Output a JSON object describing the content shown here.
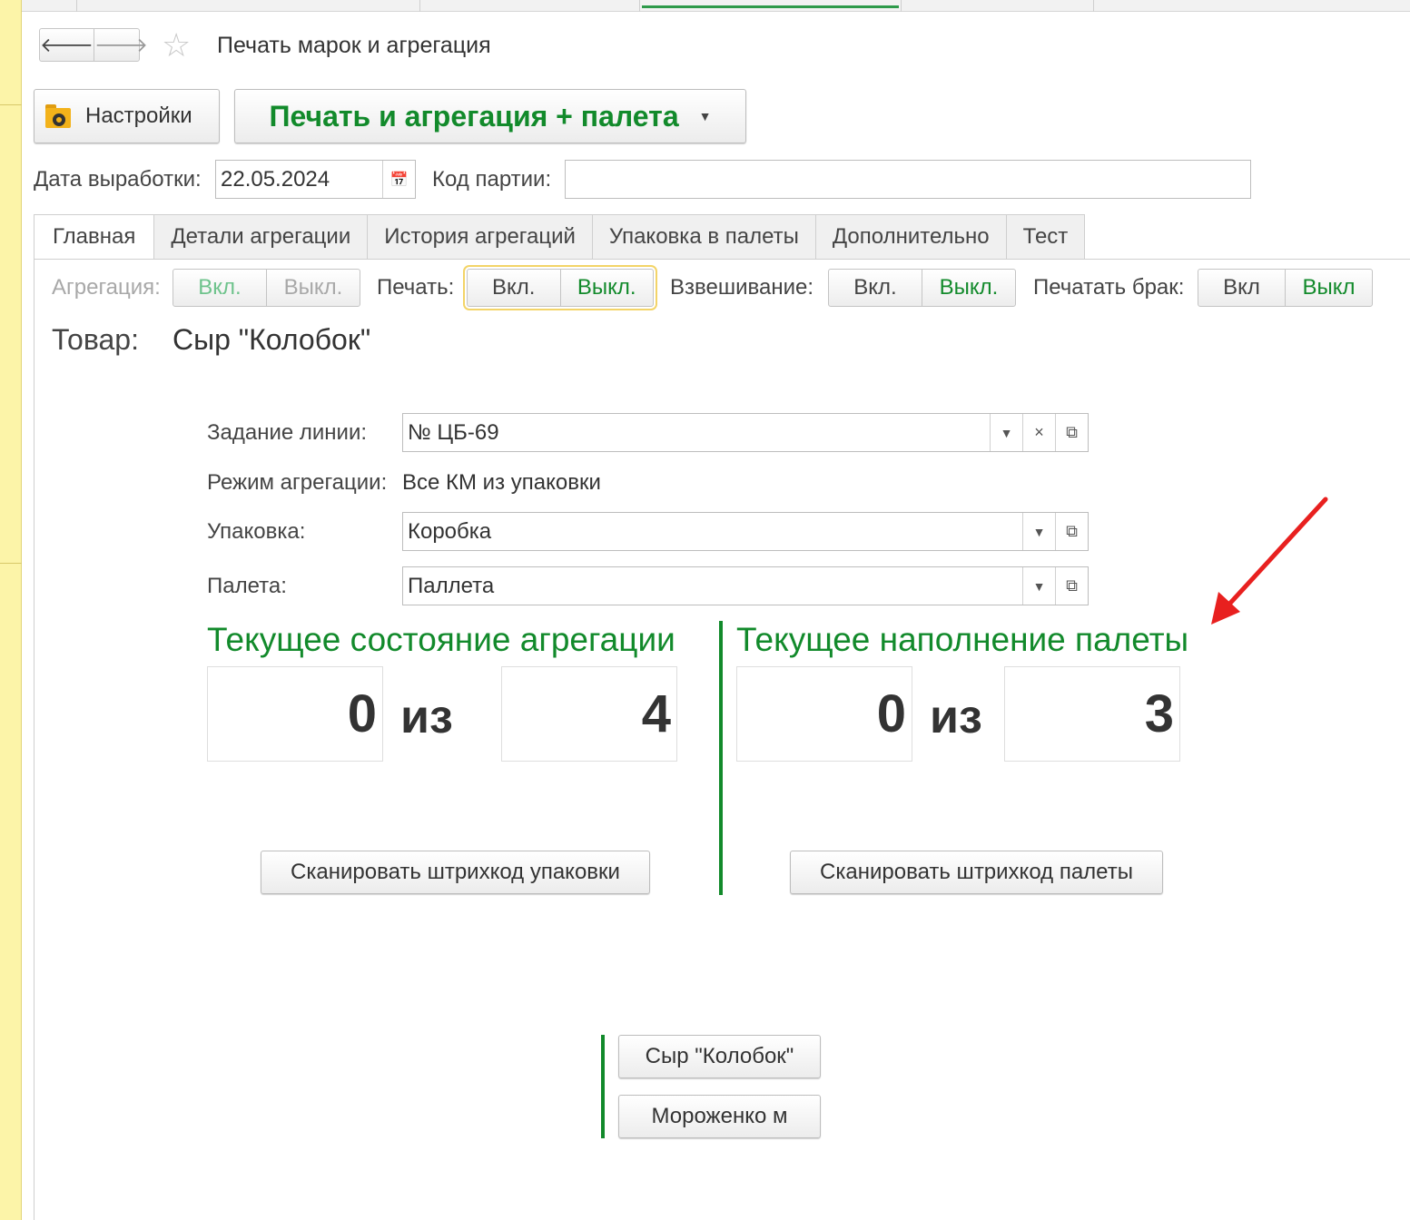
{
  "window": {
    "title": "Печать марок и агрегация"
  },
  "toolbar": {
    "settings_label": "Настройки",
    "print_agg_label": "Печать и агрегация + палета",
    "back_icon": "arrow-left-icon",
    "forward_icon": "arrow-right-icon",
    "favorite_icon": "star-icon"
  },
  "header_fields": {
    "production_date_label": "Дата выработки:",
    "production_date_value": "22.05.2024",
    "batch_code_label": "Код партии:",
    "batch_code_value": ""
  },
  "tabs": [
    "Главная",
    "Детали агрегации",
    "История агрегаций",
    "Упаковка в палеты",
    "Дополнительно",
    "Тест"
  ],
  "toggles": {
    "aggregation": {
      "label": "Агрегация:",
      "on": "Вкл.",
      "off": "Выкл.",
      "enabled": false
    },
    "print": {
      "label": "Печать:",
      "on": "Вкл.",
      "off": "Выкл.",
      "selected": "off"
    },
    "weighing": {
      "label": "Взвешивание:",
      "on": "Вкл.",
      "off": "Выкл.",
      "selected": "off"
    },
    "print_defect": {
      "label": "Печатать брак:",
      "on": "Вкл",
      "off": "Выкл",
      "selected": "off"
    }
  },
  "goods": {
    "label": "Товар:",
    "value": "Сыр \"Колобок\""
  },
  "form": {
    "line_task_label": "Задание линии:",
    "line_task_value": "№ ЦБ-69",
    "agg_mode_label": "Режим агрегации:",
    "agg_mode_value": "Все КМ из упаковки",
    "package_label": "Упаковка:",
    "package_value": "Коробка",
    "pallet_label": "Палета:",
    "pallet_value": "Паллета"
  },
  "aggregation_state": {
    "title": "Текущее состояние агрегации",
    "current": "0",
    "of": "из",
    "total": "4",
    "scan_button": "Сканировать штрихкод упаковки"
  },
  "pallet_state": {
    "title": "Текущее наполнение палеты",
    "current": "0",
    "of": "из",
    "total": "3",
    "scan_button": "Сканировать штрихкод палеты"
  },
  "product_buttons": [
    "Сыр \"Колобок\"",
    "Мороженко м"
  ],
  "colors": {
    "accent_green": "#128a2b",
    "annotation_arrow": "#e8201f"
  }
}
